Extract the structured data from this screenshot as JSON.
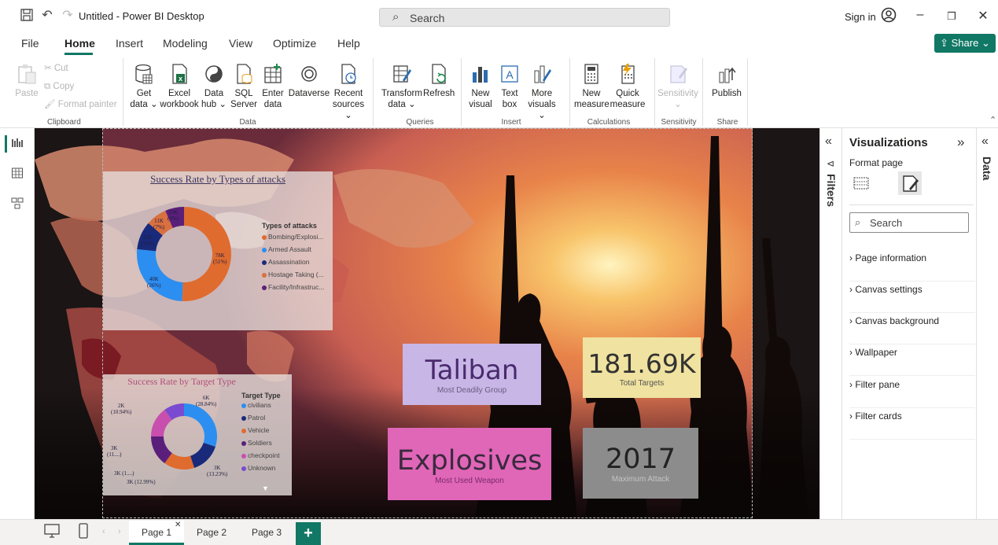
{
  "titlebar": {
    "title": "Untitled - Power BI Desktop",
    "search_placeholder": "Search",
    "signin": "Sign in"
  },
  "menu": {
    "file": "File",
    "home": "Home",
    "insert": "Insert",
    "modeling": "Modeling",
    "view": "View",
    "optimize": "Optimize",
    "help": "Help",
    "share": "Share"
  },
  "ribbon": {
    "clipboard": {
      "paste": "Paste",
      "cut": "Cut",
      "copy": "Copy",
      "format_painter": "Format painter",
      "group": "Clipboard"
    },
    "data": {
      "get_data": [
        "Get",
        "data ⌄"
      ],
      "excel": [
        "Excel",
        "workbook"
      ],
      "data_hub": [
        "Data",
        "hub ⌄"
      ],
      "sql": [
        "SQL",
        "Server"
      ],
      "enter_data": [
        "Enter",
        "data"
      ],
      "dataverse": [
        "Dataverse",
        ""
      ],
      "recent": [
        "Recent",
        "sources ⌄"
      ],
      "group": "Data"
    },
    "queries": {
      "transform": [
        "Transform",
        "data ⌄"
      ],
      "refresh": [
        "Refresh",
        ""
      ],
      "group": "Queries"
    },
    "insert": {
      "new_visual": [
        "New",
        "visual"
      ],
      "text_box": [
        "Text",
        "box"
      ],
      "more_visuals": [
        "More",
        "visuals ⌄"
      ],
      "group": "Insert"
    },
    "calculations": {
      "new_measure": [
        "New",
        "measure"
      ],
      "quick_measure": [
        "Quick",
        "measure"
      ],
      "group": "Calculations"
    },
    "sensitivity": {
      "label": [
        "Sensitivity",
        "⌄"
      ],
      "group": "Sensitivity"
    },
    "share": {
      "publish": [
        "Publish",
        ""
      ],
      "group": "Share"
    }
  },
  "visuals": {
    "donut1": {
      "title": "Success Rate by Types of attacks",
      "legend_title": "Types of attacks",
      "legend": [
        "Bombing/Explosi...",
        "Armed Assault",
        "Assassination",
        "Hostage Taking (...",
        "Facility/Infrastruc..."
      ],
      "labels": [
        "78K",
        "(51%)",
        "40K",
        "(26%)",
        "15K",
        "(10%)",
        "11K",
        "(7%)",
        "10K",
        "(6%)"
      ]
    },
    "donut2": {
      "title": "Success Rate by Target Type",
      "legend_title": "Target Type",
      "legend": [
        "civilians",
        "Patrol",
        "Vehicle",
        "Soldiers",
        "checkpoint",
        "Unknown"
      ],
      "labels": [
        "6K",
        "(28.84%)",
        "2K",
        "(10.94%)",
        "3K",
        "(11....)",
        "3K (1....)",
        "3K (12.99%)",
        "3K",
        "(13.23%)"
      ]
    },
    "cards": {
      "taliban": {
        "value": "Taliban",
        "label": "Most Deadily Group"
      },
      "targets": {
        "value": "181.69K",
        "label": "Total Targets"
      },
      "explosives": {
        "value": "Explosives",
        "label": "Most Used Weapon"
      },
      "year": {
        "value": "2017",
        "label": "Maximum Attack"
      }
    }
  },
  "chart_data": [
    {
      "type": "pie",
      "title": "Success Rate by Types of attacks",
      "legend_title": "Types of attacks",
      "categories": [
        "Bombing/Explosi...",
        "Armed Assault",
        "Assassination",
        "Hostage Taking (...",
        "Facility/Infrastruc..."
      ],
      "values": [
        78000,
        40000,
        15000,
        11000,
        10000
      ],
      "percent": [
        51,
        26,
        10,
        7,
        6
      ],
      "colors": [
        "#e06b2f",
        "#2c8ef0",
        "#1a2a7a",
        "#d9703f",
        "#5a1f7a"
      ]
    },
    {
      "type": "pie",
      "title": "Success Rate by Target Type",
      "legend_title": "Target Type",
      "categories": [
        "civilians",
        "Patrol",
        "Vehicle",
        "Soldiers",
        "checkpoint",
        "Unknown"
      ],
      "values": [
        6000,
        3000,
        3000,
        3000,
        3000,
        2000
      ],
      "percent": [
        28.84,
        13.23,
        12.99,
        11,
        11,
        10.94
      ],
      "colors": [
        "#2c8ef0",
        "#1a2a7a",
        "#e06b2f",
        "#5a1f7a",
        "#c84fae",
        "#7a4bd0"
      ]
    }
  ],
  "right_pane": {
    "filters": "Filters",
    "visualizations": "Visualizations",
    "format_page": "Format page",
    "search_placeholder": "Search",
    "sections": [
      "Page information",
      "Canvas settings",
      "Canvas background",
      "Wallpaper",
      "Filter pane",
      "Filter cards"
    ],
    "data": "Data"
  },
  "pages": {
    "page1": "Page 1",
    "page2": "Page 2",
    "page3": "Page 3",
    "add": "+"
  }
}
